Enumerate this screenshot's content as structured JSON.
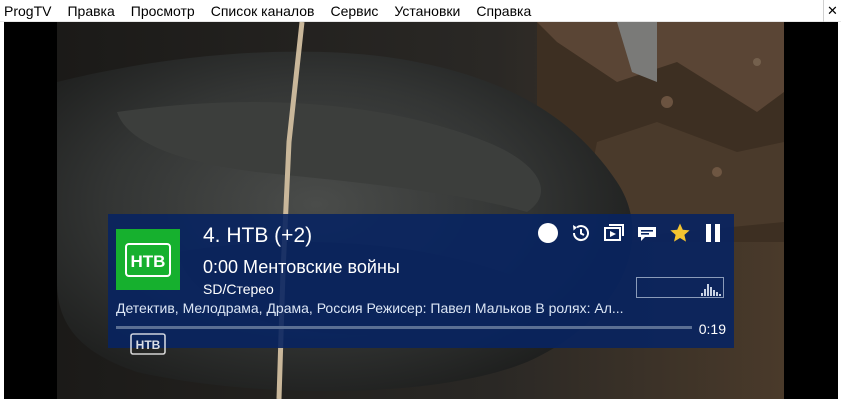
{
  "menubar": {
    "items": [
      "ProgTV",
      "Правка",
      "Просмотр",
      "Список каналов",
      "Сервис",
      "Установки",
      "Справка"
    ],
    "close_label": "✕"
  },
  "osd": {
    "channel_title": "4. НТВ (+2)",
    "program": "0:00 Ментовские войны",
    "format": "SD/Стерео",
    "description": "Детектив, Мелодрама, Драма, Россия Режисер: Павел Мальков В ролях: Ал...",
    "elapsed": "0:19",
    "progress_fraction": 0.0,
    "logo_text": "НТВ",
    "logo_color": "#16b02e",
    "controls": [
      "record-icon",
      "history-icon",
      "pip-icon",
      "subtitles-icon",
      "favorite-star-icon",
      "pause-icon"
    ],
    "favorite_color": "#f4c430"
  },
  "watermark": {
    "text": "НТВ"
  }
}
